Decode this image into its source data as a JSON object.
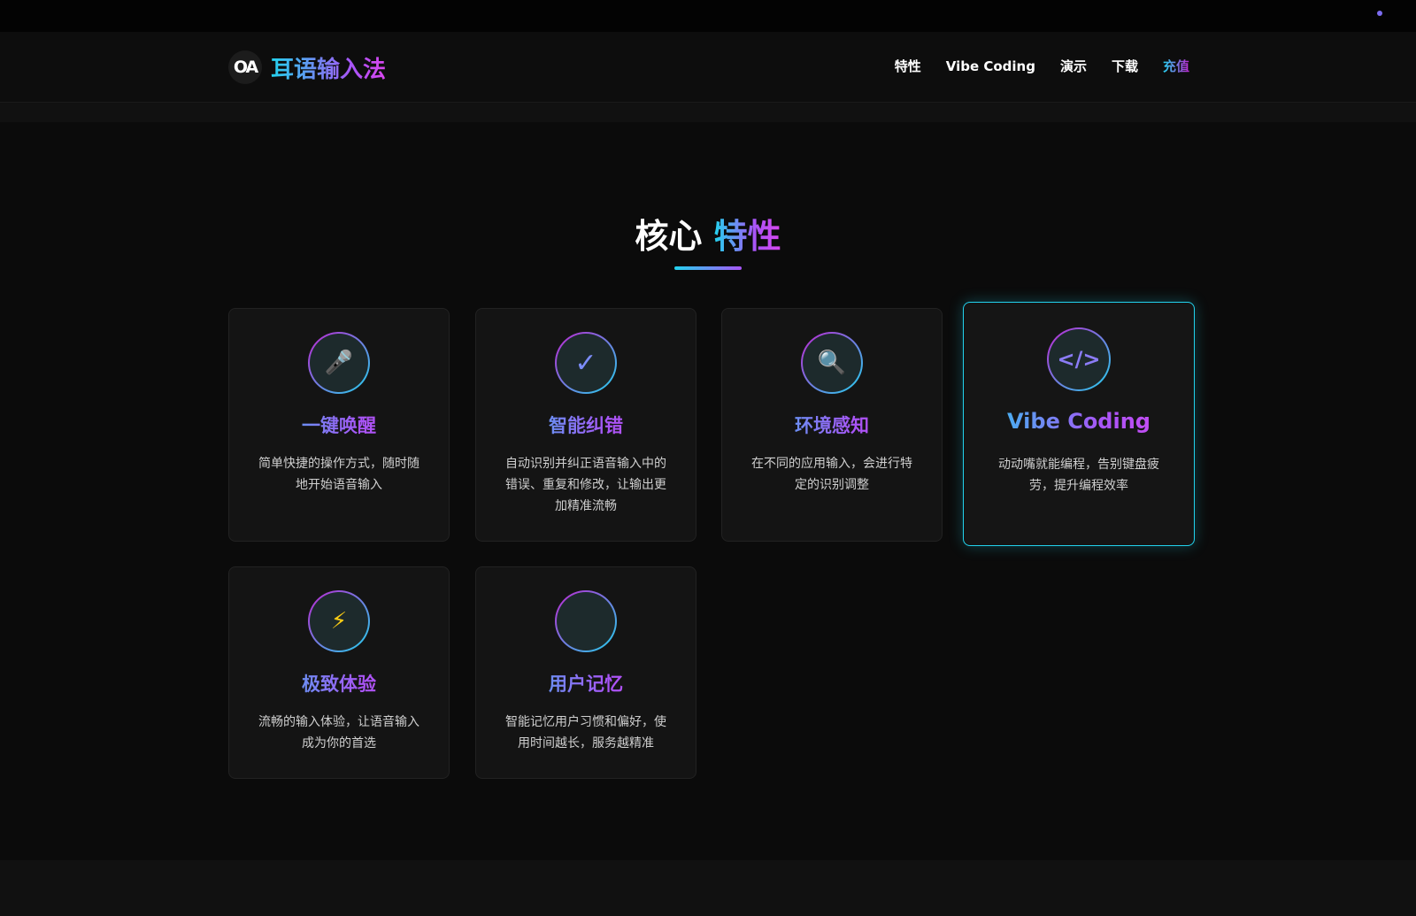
{
  "header": {
    "logo_text": "OA",
    "brand_name": "耳语输入法",
    "nav": [
      {
        "label": "特性"
      },
      {
        "label": "Vibe Coding"
      },
      {
        "label": "演示"
      },
      {
        "label": "下载"
      },
      {
        "label": "充值"
      }
    ]
  },
  "features": {
    "title_plain": "核心",
    "title_accent": "特性",
    "cards": [
      {
        "icon": "microphone-icon",
        "glyph": "🎤",
        "title": "一键唤醒",
        "desc": "简单快捷的操作方式，随时随地开始语音输入"
      },
      {
        "icon": "check-icon",
        "glyph": "✓",
        "title": "智能纠错",
        "desc": "自动识别并纠正语音输入中的错误、重复和修改，让输出更加精准流畅"
      },
      {
        "icon": "magnifier-icon",
        "glyph": "🔍",
        "title": "环境感知",
        "desc": "在不同的应用输入，会进行特定的识别调整"
      },
      {
        "icon": "code-icon",
        "glyph": "</>",
        "title": "Vibe Coding",
        "desc": "动动嘴就能编程，告别键盘疲劳，提升编程效率"
      },
      {
        "icon": "lightning-icon",
        "glyph": "⚡",
        "title": "极致体验",
        "desc": "流畅的输入体验，让语音输入成为你的首选"
      },
      {
        "icon": "memory-icon",
        "glyph": "",
        "title": "用户记忆",
        "desc": "智能记忆用户习惯和偏好，使用时间越长，服务越精准"
      }
    ]
  },
  "colors": {
    "accent_cyan": "#22d3ee",
    "accent_purple": "#a855f7",
    "accent_magenta": "#d946ef",
    "background": "#0b0b0b"
  }
}
